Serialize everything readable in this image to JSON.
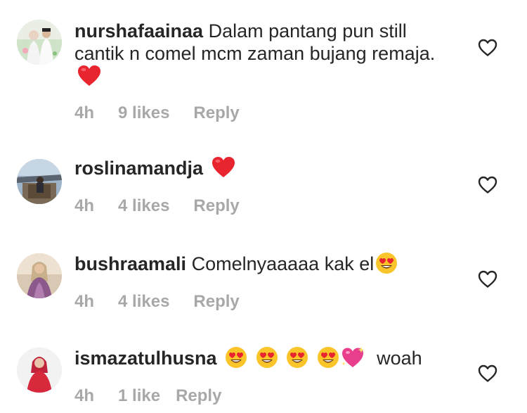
{
  "comments": [
    {
      "username": "nurshafaainaa",
      "text": "Dalam pantang pun still cantik n comel mcm zaman bujang remaja.",
      "emojis": [
        "red-heart"
      ],
      "time": "4h",
      "likes": "9 likes",
      "reply": "Reply"
    },
    {
      "username": "roslinamandja",
      "text": "",
      "emojis": [
        "red-heart"
      ],
      "time": "4h",
      "likes": "4 likes",
      "reply": "Reply"
    },
    {
      "username": "bushraamali",
      "text": "Comelnyaaaaa kak el",
      "emojis": [
        "heart-eyes-face"
      ],
      "time": "4h",
      "likes": "4 likes",
      "reply": "Reply"
    },
    {
      "username": "ismazatulhusna",
      "text": "woah",
      "emojis": [
        "heart-eyes-face",
        "heart-eyes-face",
        "heart-eyes-face",
        "heart-eyes-face",
        "sparkling-heart"
      ],
      "time": "4h",
      "likes": "1 like",
      "reply": "Reply"
    }
  ],
  "colors": {
    "text": "#262626",
    "meta": "#a8a8a8",
    "heart_red": "#e8242f",
    "emoji_yellow": "#f9c52b",
    "sparkle_pink": "#e83e8c"
  }
}
